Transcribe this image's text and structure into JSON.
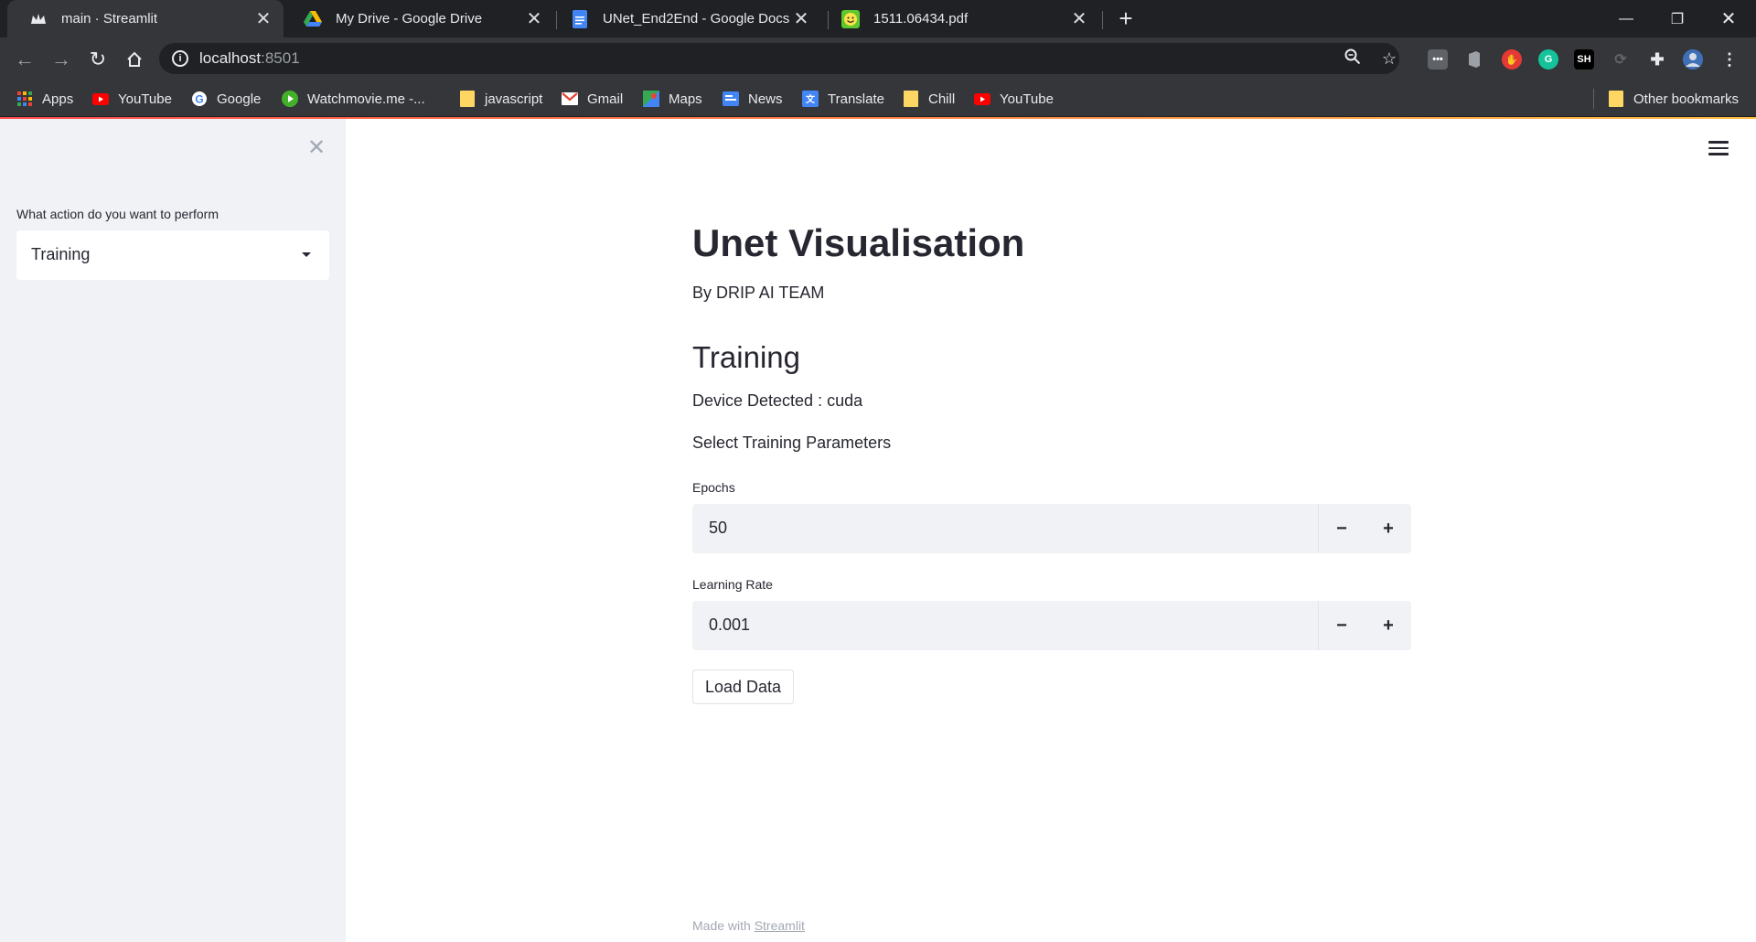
{
  "browser": {
    "tabs": [
      {
        "title": "main · Streamlit",
        "icon": "streamlit-crown-icon",
        "active": true
      },
      {
        "title": "My Drive - Google Drive",
        "icon": "google-drive-icon",
        "active": false
      },
      {
        "title": "UNet_End2End - Google Docs",
        "icon": "google-docs-icon",
        "active": false
      },
      {
        "title": "1511.06434.pdf",
        "icon": "pdf-smiley-icon",
        "active": false
      }
    ],
    "url_host": "localhost",
    "url_port": ":8501",
    "bookmarks": [
      {
        "label": "Apps",
        "icon": "apps-grid-icon"
      },
      {
        "label": "YouTube",
        "icon": "youtube-icon"
      },
      {
        "label": "Google",
        "icon": "google-icon"
      },
      {
        "label": "Watchmovie.me -...",
        "icon": "play-icon"
      },
      {
        "label": "javascript",
        "icon": "folder-icon"
      },
      {
        "label": "Gmail",
        "icon": "gmail-icon"
      },
      {
        "label": "Maps",
        "icon": "maps-icon"
      },
      {
        "label": "News",
        "icon": "news-icon"
      },
      {
        "label": "Translate",
        "icon": "translate-icon"
      },
      {
        "label": "Chill",
        "icon": "folder-icon"
      },
      {
        "label": "YouTube",
        "icon": "youtube-icon"
      },
      {
        "label": "Other bookmarks",
        "icon": "folder-icon"
      }
    ]
  },
  "sidebar": {
    "select_label": "What action do you want to perform",
    "select_value": "Training"
  },
  "main": {
    "title": "Unet Visualisation",
    "byline": "By DRIP AI TEAM",
    "section_heading": "Training",
    "device_text": "Device Detected : cuda",
    "params_text": "Select Training Parameters",
    "epochs": {
      "label": "Epochs",
      "value": "50"
    },
    "learning_rate": {
      "label": "Learning Rate",
      "value": "0.001"
    },
    "load_button": "Load Data"
  },
  "footer": {
    "prefix": "Made with ",
    "link": "Streamlit"
  },
  "colors": {
    "accent": "#ff4b4b",
    "sidebar_bg": "#f0f2f6",
    "text": "#262730",
    "chrome_dark": "#202124",
    "chrome_toolbar": "#35363a"
  }
}
